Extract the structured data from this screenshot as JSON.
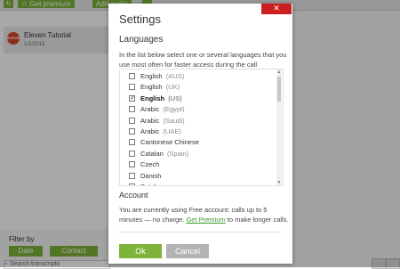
{
  "app": {
    "toolbar": {
      "get_premium": "Get premium",
      "add_audio": "Add audio"
    },
    "tutorial": {
      "avatar": "ELEVEN",
      "title": "Eleven Tutorial",
      "date": "1/1/2013"
    },
    "filter": {
      "label": "Filter by",
      "date_btn": "Date",
      "contact_btn": "Contact"
    },
    "search": {
      "placeholder": "Search transcripts"
    }
  },
  "dialog": {
    "title": "Settings",
    "close": "✕",
    "languages_heading": "Languages",
    "languages_desc": "In the list below select one or several languages that you use most often for faster access during the call",
    "languages": [
      {
        "name": "English",
        "region": "(AUS)",
        "checked": false
      },
      {
        "name": "English",
        "region": "(UK)",
        "checked": false
      },
      {
        "name": "English",
        "region": "(US)",
        "checked": true
      },
      {
        "name": "Arabic",
        "region": "(Egypt)",
        "checked": false
      },
      {
        "name": "Arabic",
        "region": "(Saudi)",
        "checked": false
      },
      {
        "name": "Arabic",
        "region": "(UAE)",
        "checked": false
      },
      {
        "name": "Cantonese Chinese",
        "region": "",
        "checked": false
      },
      {
        "name": "Catalan",
        "region": "(Spain)",
        "checked": false
      },
      {
        "name": "Czech",
        "region": "",
        "checked": false
      },
      {
        "name": "Danish",
        "region": "",
        "checked": false
      },
      {
        "name": "Dutch",
        "region": "",
        "checked": false
      }
    ],
    "account_heading": "Account",
    "account_text_1": "You are currently using Free account: calls up to 5 minutes — no charge.",
    "account_link": "Get Premium",
    "account_text_2": "to make longer calls.",
    "ok": "Ok",
    "cancel": "Cancel"
  },
  "colors": {
    "accent": "#7fb33a",
    "close": "#cc1f1f",
    "link": "#3b9a2a"
  }
}
